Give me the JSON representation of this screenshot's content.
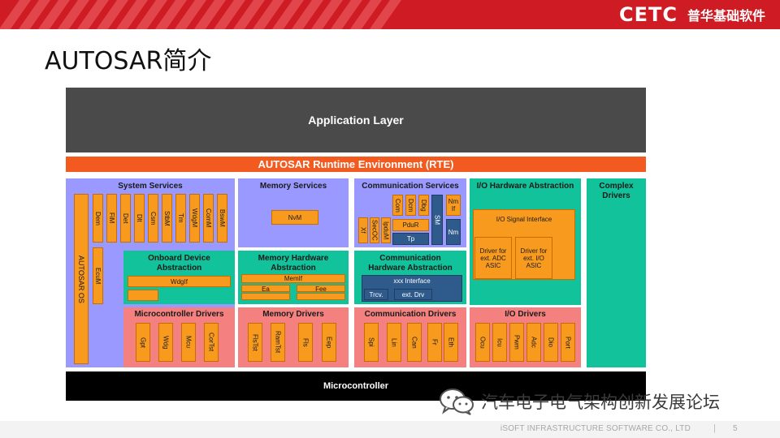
{
  "header": {
    "logo_mark": "CETC",
    "logo_text": "普华基础软件"
  },
  "title": "AUTOSAR简介",
  "colors": {
    "header_red": "#cf1c24",
    "application_layer": "#4a4a4a",
    "rte": "#f25a1f",
    "services": "#9999ff",
    "hardware_abstraction": "#11c29a",
    "drivers": "#f4817f",
    "module": "#f79a1e",
    "navy_module": "#2e5a8c",
    "microcontroller": "#000000"
  },
  "diagram": {
    "application_layer": "Application Layer",
    "rte": "AUTOSAR Runtime Environment (RTE)",
    "system_services": {
      "title": "System Services",
      "modules": [
        "Dem",
        "FiM",
        "Det",
        "Dlt",
        "Csm",
        "StbM",
        "Tm",
        "WdgM",
        "ComM",
        "BswM"
      ],
      "os": "AUTOSAR OS",
      "ecum": "EcuM"
    },
    "memory_services": {
      "title": "Memory Services",
      "nvm": "NvM"
    },
    "communication_services": {
      "title": "Communication Services",
      "com": "Com",
      "dcm": "Dcm",
      "dbg": "Dbg",
      "nm_if": "Nm If",
      "xf": "Xf",
      "secoc": "SecOC",
      "ipdum": "IpduM",
      "pdur": "PduR",
      "sm": "SM",
      "tp": "Tp",
      "nm": "Nm"
    },
    "io_hardware_abstraction": {
      "title": "I/O Hardware Abstraction",
      "signal_interface": "I/O Signal Interface",
      "driver_adc": "Driver for ext. ADC ASIC",
      "driver_io": "Driver for ext. I/O ASIC"
    },
    "complex_drivers": "Complex Drivers",
    "onboard_device_abstraction": {
      "title": "Onboard Device Abstraction",
      "wdgif": "WdgIf"
    },
    "memory_hardware_abstraction": {
      "title": "Memory Hardware Abstraction",
      "memif": "MemIf",
      "ea": "Ea",
      "fee": "Fee"
    },
    "communication_hardware_abstraction": {
      "title": "Communication Hardware Abstraction",
      "xxx_interface": "xxx Interface",
      "trcv": "Trcv.",
      "ext_drv": "ext. Drv"
    },
    "microcontroller_drivers": {
      "title": "Microcontroller Drivers",
      "modules": [
        "Gpt",
        "Wdg",
        "Mcu",
        "CorTst"
      ]
    },
    "memory_drivers": {
      "title": "Memory Drivers",
      "modules": [
        "FlsTst",
        "RamTst",
        "Fls",
        "Eep"
      ]
    },
    "communication_drivers": {
      "title": "Communication Drivers",
      "modules": [
        "Spi",
        "Lin",
        "Can",
        "Fr",
        "Eth"
      ]
    },
    "io_drivers": {
      "title": "I/O Drivers",
      "modules": [
        "Ocu",
        "Icu",
        "Pwm",
        "Adc",
        "Dio",
        "Port"
      ]
    },
    "microcontroller": "Microcontroller"
  },
  "watermark": {
    "icon": "wechat-icon",
    "text": "汽车电子电气架构创新发展论坛"
  },
  "footer": {
    "company": "iSOFT INFRASTRUCTURE SOFTWARE CO., LTD",
    "separator": "|",
    "page_number": "5"
  }
}
